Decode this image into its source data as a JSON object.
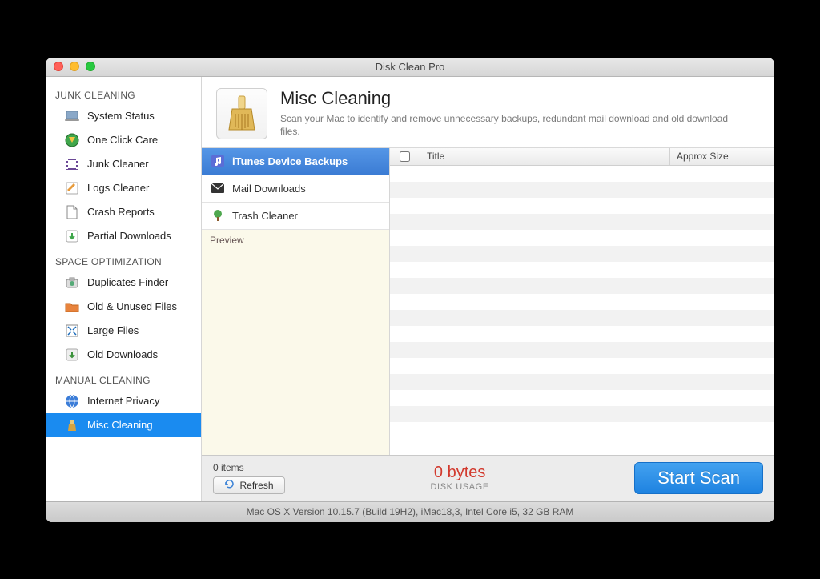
{
  "window_title": "Disk Clean Pro",
  "sidebar": {
    "groups": [
      {
        "label": "JUNK CLEANING",
        "items": [
          {
            "label": "System Status",
            "icon": "laptop"
          },
          {
            "label": "One Click Care",
            "icon": "globe-arrow"
          },
          {
            "label": "Junk Cleaner",
            "icon": "film"
          },
          {
            "label": "Logs Cleaner",
            "icon": "pencil"
          },
          {
            "label": "Crash Reports",
            "icon": "doc"
          },
          {
            "label": "Partial Downloads",
            "icon": "down-arrow"
          }
        ]
      },
      {
        "label": "SPACE OPTIMIZATION",
        "items": [
          {
            "label": "Duplicates Finder",
            "icon": "camera"
          },
          {
            "label": "Old & Unused Files",
            "icon": "folder"
          },
          {
            "label": "Large Files",
            "icon": "expand"
          },
          {
            "label": "Old Downloads",
            "icon": "down-box"
          }
        ]
      },
      {
        "label": "MANUAL CLEANING",
        "items": [
          {
            "label": "Internet Privacy",
            "icon": "globe"
          },
          {
            "label": "Misc Cleaning",
            "icon": "brush",
            "selected": true
          }
        ]
      }
    ]
  },
  "header": {
    "title": "Misc Cleaning",
    "subtitle": "Scan your Mac to identify and remove unnecessary backups, redundant mail download and old download files."
  },
  "categories": [
    {
      "label": "iTunes Device Backups",
      "icon": "music",
      "selected": true
    },
    {
      "label": "Mail Downloads",
      "icon": "envelope"
    },
    {
      "label": "Trash Cleaner",
      "icon": "tree"
    }
  ],
  "preview_label": "Preview",
  "table": {
    "columns": {
      "title": "Title",
      "size": "Approx Size"
    },
    "row_count": 17
  },
  "footer": {
    "items_text": "0 items",
    "refresh_label": "Refresh",
    "bytes_text": "0 bytes",
    "usage_label": "DISK USAGE",
    "scan_label": "Start Scan"
  },
  "status_text": "Mac OS X Version 10.15.7 (Build 19H2), iMac18,3, Intel Core i5, 32 GB RAM"
}
